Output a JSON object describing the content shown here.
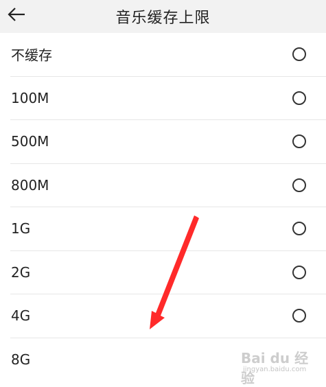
{
  "header": {
    "title": "音乐缓存上限",
    "back_icon": "arrow-left-icon"
  },
  "options": [
    {
      "label": "不缓存",
      "selected": false
    },
    {
      "label": "100M",
      "selected": false
    },
    {
      "label": "500M",
      "selected": false
    },
    {
      "label": "800M",
      "selected": false
    },
    {
      "label": "1G",
      "selected": false
    },
    {
      "label": "2G",
      "selected": false
    },
    {
      "label": "4G",
      "selected": false
    },
    {
      "label": "8G",
      "selected": false
    }
  ],
  "annotation": {
    "arrow_color": "#ff2a2a"
  },
  "watermark": {
    "line1": "Bai du 经验",
    "line2": "jingyan.baidu.com"
  }
}
